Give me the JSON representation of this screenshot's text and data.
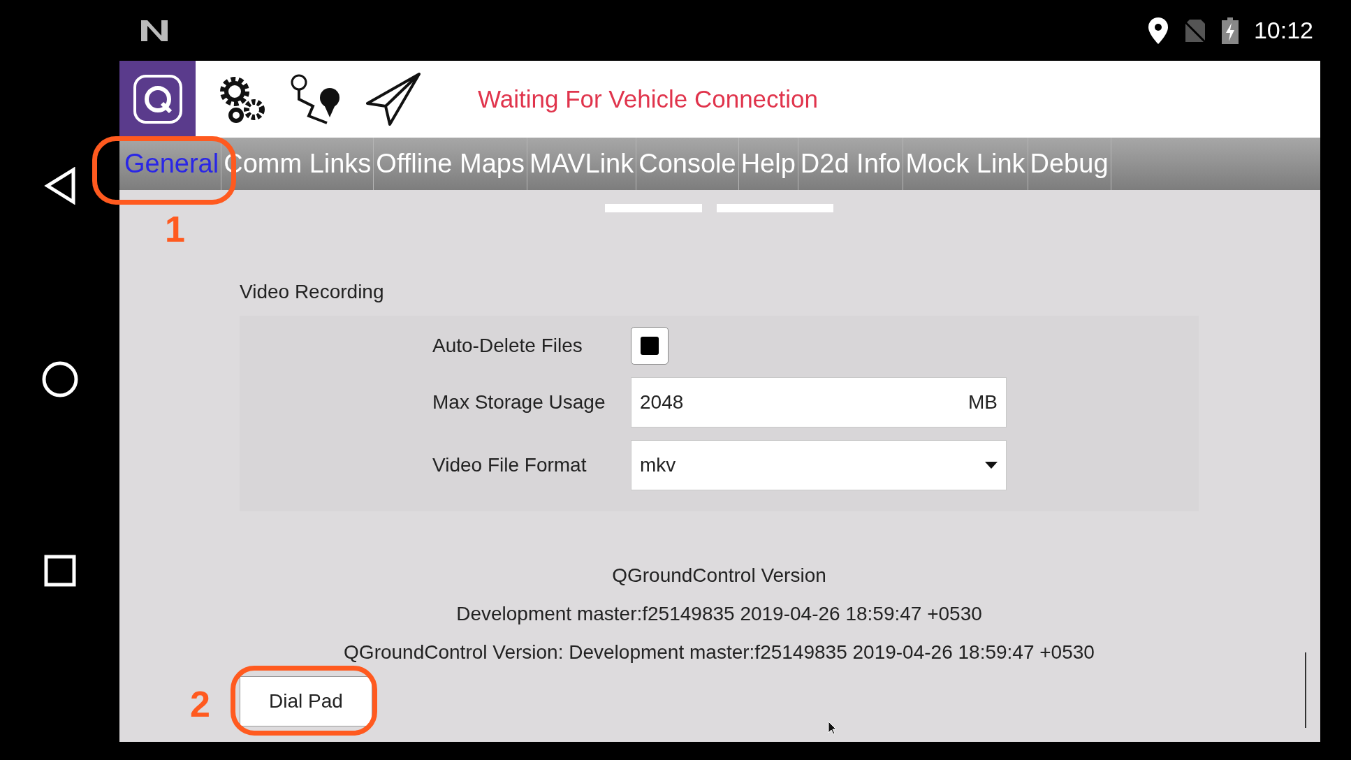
{
  "status_bar": {
    "time": "10:12"
  },
  "toolbar": {
    "status": "Waiting For Vehicle Connection"
  },
  "tabs": [
    {
      "label": "General",
      "selected": true
    },
    {
      "label": "Comm Links",
      "selected": false
    },
    {
      "label": "Offline Maps",
      "selected": false
    },
    {
      "label": "MAVLink",
      "selected": false
    },
    {
      "label": "Console",
      "selected": false
    },
    {
      "label": "Help",
      "selected": false
    },
    {
      "label": "D2d Info",
      "selected": false
    },
    {
      "label": "Mock Link",
      "selected": false
    },
    {
      "label": "Debug",
      "selected": false
    }
  ],
  "video_recording": {
    "title": "Video Recording",
    "fields": [
      {
        "kind": "checkbox",
        "label": "Auto-Delete Files",
        "checked": true
      },
      {
        "kind": "number",
        "label": "Max Storage Usage",
        "value": "2048",
        "unit": "MB"
      },
      {
        "kind": "dropdown",
        "label": "Video File Format",
        "value": "mkv"
      }
    ]
  },
  "version": {
    "heading": "QGroundControl Version",
    "value": "Development master:f25149835 2019-04-26 18:59:47 +0530",
    "full": "QGroundControl Version: Development master:f25149835 2019-04-26 18:59:47 +0530"
  },
  "dial_pad_button": "Dial Pad",
  "annotations": [
    {
      "label": "1"
    },
    {
      "label": "2"
    }
  ]
}
